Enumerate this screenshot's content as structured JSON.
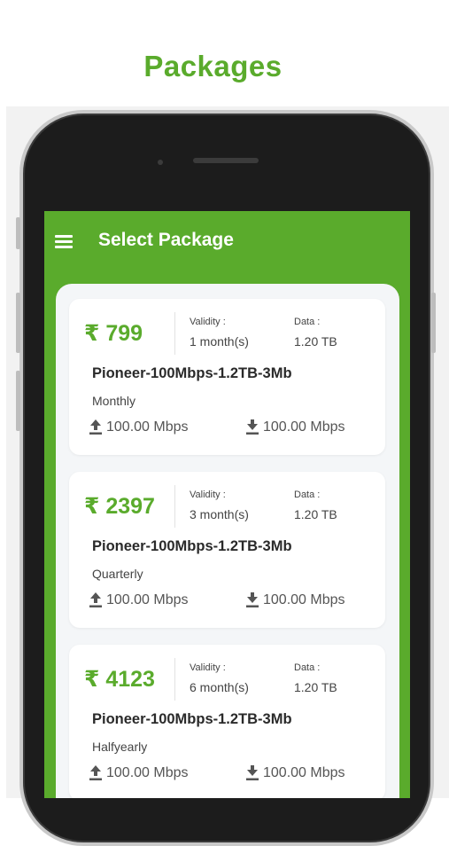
{
  "page_title": "Packages",
  "app": {
    "title": "Select Package"
  },
  "labels": {
    "validity": "Validity :",
    "data": "Data :"
  },
  "packages": [
    {
      "price": "₹ 799",
      "validity": "1 month(s)",
      "data": "1.20 TB",
      "name": "Pioneer-100Mbps-1.2TB-3Mb",
      "period": "Monthly",
      "upload": "100.00 Mbps",
      "download": "100.00 Mbps"
    },
    {
      "price": "₹ 2397",
      "validity": "3 month(s)",
      "data": "1.20 TB",
      "name": "Pioneer-100Mbps-1.2TB-3Mb",
      "period": "Quarterly",
      "upload": "100.00 Mbps",
      "download": "100.00 Mbps"
    },
    {
      "price": "₹ 4123",
      "validity": "6 month(s)",
      "data": "1.20 TB",
      "name": "Pioneer-100Mbps-1.2TB-3Mb",
      "period": "Halfyearly",
      "upload": "100.00 Mbps",
      "download": "100.00 Mbps"
    }
  ],
  "icons": {
    "menu": "hamburger-menu-icon",
    "upload": "upload-icon",
    "download": "download-icon"
  },
  "colors": {
    "accent": "#5aab2c",
    "phone_body": "#1c1c1c",
    "card_bg": "#ffffff",
    "content_bg": "#f4f6f8"
  }
}
